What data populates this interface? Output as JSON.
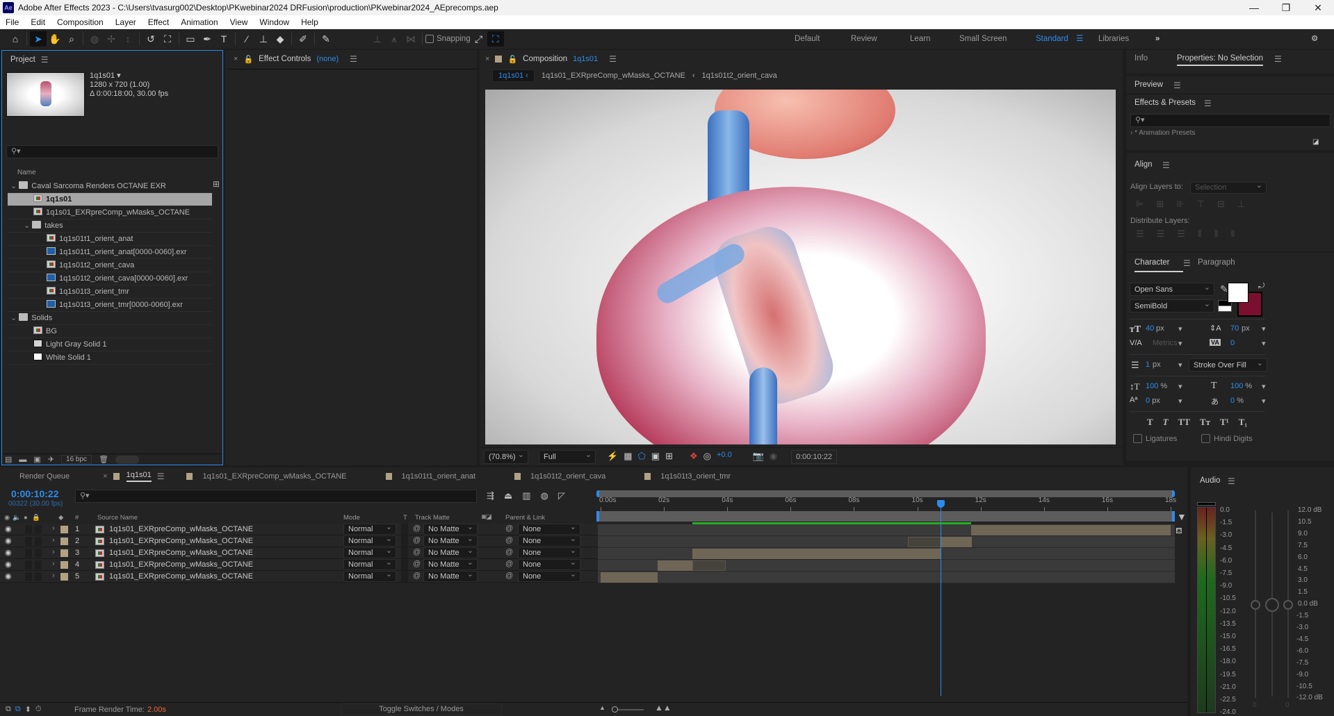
{
  "window": {
    "title": "Adobe After Effects 2023 - C:\\Users\\tvasurg002\\Desktop\\PKwebinar2024 DRFusion\\production\\PKwebinar2024_AEprecomps.aep",
    "app_badge": "Ae",
    "controls": [
      "—",
      "❐",
      "✕"
    ]
  },
  "menu": [
    "File",
    "Edit",
    "Composition",
    "Layer",
    "Effect",
    "Animation",
    "View",
    "Window",
    "Help"
  ],
  "toolbar": {
    "snapping_label": "Snapping",
    "snapping_checked": false,
    "workspaces": [
      "Default",
      "Review",
      "Learn",
      "Small Screen",
      "Standard",
      "Libraries"
    ],
    "active_workspace": "Standard",
    "overflow": "»"
  },
  "project": {
    "title": "Project",
    "selected_name": "1q1s01",
    "selected_res": "1280 x 720 (1.00)",
    "selected_duration": "Δ 0:00:18:00, 30.00 fps",
    "search_placeholder": "",
    "column_name": "Name",
    "items": [
      {
        "name": "Caval Sarcoma Renders OCTANE EXR",
        "type": "folder",
        "indent": 0,
        "expanded": true
      },
      {
        "name": "1q1s01",
        "type": "comp",
        "indent": 1,
        "selected": true
      },
      {
        "name": "1q1s01_EXRpreComp_wMasks_OCTANE",
        "type": "comp",
        "indent": 1
      },
      {
        "name": "takes",
        "type": "folder",
        "indent": 1,
        "expanded": true
      },
      {
        "name": "1q1s01t1_orient_anat",
        "type": "comp",
        "indent": 2
      },
      {
        "name": "1q1s01t1_orient_anat[0000-0060].exr",
        "type": "sequence",
        "indent": 2
      },
      {
        "name": "1q1s01t2_orient_cava",
        "type": "comp",
        "indent": 2
      },
      {
        "name": "1q1s01t2_orient_cava[0000-0060].exr",
        "type": "sequence",
        "indent": 2
      },
      {
        "name": "1q1s01t3_orient_tmr",
        "type": "comp",
        "indent": 2
      },
      {
        "name": "1q1s01t3_orient_tmr[0000-0060].exr",
        "type": "sequence",
        "indent": 2
      },
      {
        "name": "Solids",
        "type": "folder",
        "indent": 0,
        "expanded": true
      },
      {
        "name": "BG",
        "type": "comp",
        "indent": 1
      },
      {
        "name": "Light Gray Solid 1",
        "type": "solid-gray",
        "indent": 1
      },
      {
        "name": "White Solid 1",
        "type": "solid-white",
        "indent": 1
      }
    ],
    "bpc": "16 bpc"
  },
  "effect_controls": {
    "title": "Effect Controls",
    "target": "(none)"
  },
  "composition": {
    "title": "Composition",
    "name": "1q1s01",
    "breadcrumbs": [
      "1q1s01",
      "1q1s01_EXRpreComp_wMasks_OCTANE",
      "1q1s01t2_orient_cava"
    ],
    "zoom": "(70.8%)",
    "resolution": "Full",
    "exposure": "+0.0",
    "timecode": "0:00:10:22"
  },
  "right_panel": {
    "tabs": [
      "Info",
      "Properties: No Selection"
    ],
    "preview": "Preview",
    "effects_presets": "Effects & Presets",
    "effects_search_placeholder": "",
    "animation_presets": "* Animation Presets",
    "align": {
      "title": "Align",
      "align_to_label": "Align Layers to:",
      "align_to_value": "Selection",
      "distribute_label": "Distribute Layers:"
    },
    "character": {
      "tabs": [
        "Character",
        "Paragraph"
      ],
      "font": "Open Sans",
      "style": "SemiBold",
      "font_size": "40",
      "leading": "70",
      "kerning": "Metrics",
      "tracking": "0",
      "stroke_width": "1",
      "stroke_mode": "Stroke Over Fill",
      "vert_scale": "100",
      "horiz_scale": "100",
      "baseline_shift": "0",
      "tsume": "0",
      "unit_px": "px",
      "unit_pct": "%",
      "fill_color": "#ffffff",
      "stroke_color": "#7a1030",
      "ligatures": "Ligatures",
      "hindi_digits": "Hindi Digits",
      "text_styles": [
        "T",
        "T",
        "TT",
        "Tт",
        "T¹",
        "T₁"
      ]
    }
  },
  "timeline": {
    "tabs": [
      "Render Queue",
      "1q1s01",
      "1q1s01_EXRpreComp_wMasks_OCTANE",
      "1q1s01t1_orient_anat",
      "1q1s01t2_orient_cava",
      "1q1s01t3_orient_tmr"
    ],
    "active_tab": "1q1s01",
    "timecode": "0:00:10:22",
    "frame_info": "00322 (30.00 fps)",
    "columns": {
      "source_name": "Source Name",
      "mode": "Mode",
      "t": "T",
      "track_matte": "Track Matte",
      "parent": "Parent & Link",
      "num": "#"
    },
    "ruler": [
      "0:00s",
      "02s",
      "04s",
      "06s",
      "08s",
      "10s",
      "12s",
      "14s",
      "16s",
      "18s"
    ],
    "duration_s": 18,
    "playhead_s": 10.73,
    "work_area_s": [
      2.9,
      11.7
    ],
    "layers": [
      {
        "num": "1",
        "name": "1q1s01_EXRpreComp_wMasks_OCTANE",
        "mode": "Normal",
        "matte": "No Matte",
        "parent": "None",
        "in_s": 11.7,
        "out_s": 18,
        "ghost_in_s": null,
        "ghost_out_s": null
      },
      {
        "num": "2",
        "name": "1q1s01_EXRpreComp_wMasks_OCTANE",
        "mode": "Normal",
        "matte": "No Matte",
        "parent": "None",
        "in_s": 10.73,
        "out_s": 11.73,
        "ghost_in_s": 9.7,
        "ghost_out_s": 10.73
      },
      {
        "num": "3",
        "name": "1q1s01_EXRpreComp_wMasks_OCTANE",
        "mode": "Normal",
        "matte": "No Matte",
        "parent": "None",
        "in_s": 2.9,
        "out_s": 10.75,
        "ghost_in_s": null,
        "ghost_out_s": null
      },
      {
        "num": "4",
        "name": "1q1s01_EXRpreComp_wMasks_OCTANE",
        "mode": "Normal",
        "matte": "No Matte",
        "parent": "None",
        "in_s": 1.8,
        "out_s": 2.9,
        "ghost_in_s": 2.9,
        "ghost_out_s": 3.95
      },
      {
        "num": "5",
        "name": "1q1s01_EXRpreComp_wMasks_OCTANE",
        "mode": "Normal",
        "matte": "No Matte",
        "parent": "None",
        "in_s": 0,
        "out_s": 1.8,
        "ghost_in_s": null,
        "ghost_out_s": null
      }
    ],
    "frame_render_label": "Frame Render Time:",
    "frame_render_value": "2.00s",
    "toggle_label": "Toggle Switches / Modes"
  },
  "audio": {
    "title": "Audio",
    "left_scale": [
      "0.0",
      "-1.5",
      "-3.0",
      "-4.5",
      "-6.0",
      "-7.5",
      "-9.0",
      "-10.5",
      "-12.0",
      "-13.5",
      "-15.0",
      "-16.5",
      "-18.0",
      "-19.5",
      "-21.0",
      "-22.5",
      "-24.0"
    ],
    "right_scale": [
      "12.0 dB",
      "10.5",
      "9.0",
      "7.5",
      "6.0",
      "4.5",
      "3.0",
      "1.5",
      "0.0 dB",
      "-1.5",
      "-3.0",
      "-4.5",
      "-6.0",
      "-7.5",
      "-9.0",
      "-10.5",
      "-12.0 dB"
    ],
    "left_channel": "0",
    "right_channel": "0"
  }
}
